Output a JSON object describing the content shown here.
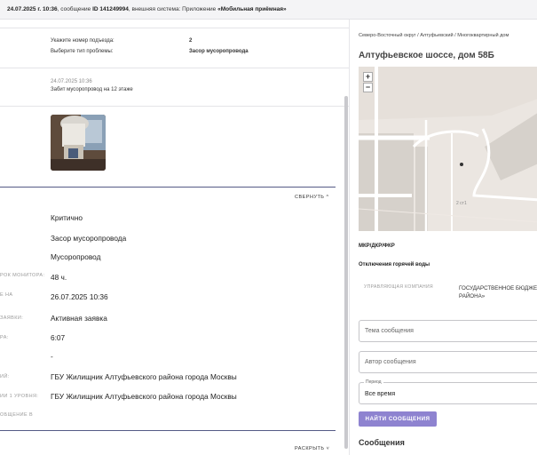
{
  "topbar": {
    "date": "24.07.2025 г. 10:36",
    "text1": ", сообщение ",
    "id": "ID 141249994",
    "text2": ", внешняя система: Приложение ",
    "system": "«Мобильная приёмная»"
  },
  "left": {
    "entrance_label": "Укажите номер подъезда:",
    "entrance_value": "2",
    "problem_label": "Выберите тип проблемы:",
    "problem_value": "Засор мусоропровода",
    "comment_date": "24.07.2025 10:36",
    "comment_text": "Забит мусоропровод на 12 этаже",
    "collapse_label": "СВЕРНУТЬ",
    "expand_label": "РАСКРЫТЬ",
    "details": [
      {
        "label": "",
        "value": "Критично"
      },
      {
        "label": "",
        "value": "Засор мусоропровода"
      },
      {
        "label": "",
        "value": "Мусоропровод"
      },
      {
        "label": "РОК МОНИТОРА:",
        "value": "48 ч."
      },
      {
        "label": "Е НА",
        "value": "26.07.2025 10:36"
      },
      {
        "label": "ЗАЯВКИ:",
        "value": "Активная заявка"
      },
      {
        "label": "РА:",
        "value": "6:07"
      },
      {
        "label": "",
        "value": "-"
      },
      {
        "label": "ИЙ:",
        "value": "ГБУ Жилищник Алтуфьевского района города Москвы"
      },
      {
        "label": "ИИ 1 УРОВНЯ:",
        "value": "ГБУ Жилищник Алтуфьевского района города Москвы"
      },
      {
        "label": "ОБЩЕНИЕ В",
        "value": ""
      }
    ]
  },
  "right": {
    "breadcrumb": "Северо-Восточный округ / Алтуфьевский / Многоквартирный дом",
    "title": "Алтуфьевское шоссе, дом 58Б",
    "zoom_in": "+",
    "zoom_out": "−",
    "map_label": "2 ст1",
    "kind": "МКР/ДКР/ФКР",
    "hot_water": "Отключения горячей воды",
    "uk_label": "УПРАВЛЯЮЩАЯ КОМПАНИЯ",
    "uk_value": "ГОСУДАРСТВЕННОЕ БЮДЖЕТ РАЙОНА»",
    "topic_placeholder": "Тема сообщения",
    "author_placeholder": "Автор сообщения",
    "period_legend": "Период",
    "period_value": "Все время",
    "search_button": "НАЙТИ СООБЩЕНИЯ",
    "messages_heading": "Сообщения"
  },
  "colors": {
    "accent": "#8e83d0",
    "divider": "#555b86"
  }
}
